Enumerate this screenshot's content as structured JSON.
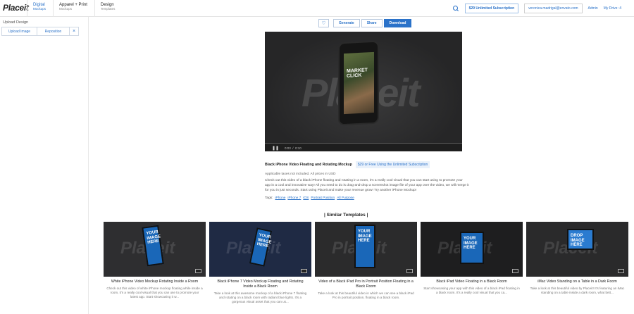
{
  "header": {
    "logo": "Placeit",
    "nav": [
      {
        "title": "Digital",
        "sub": "Mockups"
      },
      {
        "title": "Apparel + Print",
        "sub": "Mockups"
      },
      {
        "title": "Design",
        "sub": "Templates"
      }
    ],
    "subscription_label": "$29 Unlimited Subscription",
    "email": "veronica.madrigal@envato.com",
    "admin_label": "Admin",
    "drive_label": "My Drive: 4"
  },
  "sidebar": {
    "title": "Upload Design",
    "upload_label": "Upload Image",
    "reposition_label": "Reposition",
    "close_glyph": "×"
  },
  "actions": {
    "heart_glyph": "♡",
    "generate_label": "Generate",
    "share_label": "Share",
    "download_label": "Download"
  },
  "player": {
    "watermark": "Placeit",
    "screen_text": "MARKET\nCLICK",
    "pause_glyph": "❚❚",
    "time": "0:03  /  0:10"
  },
  "product": {
    "title": "Black iPhone Video Floating and Rotating Mockup",
    "price": "$29 or Free Using the Unlimited Subscription",
    "note": "Applicable taxes not included. All prices in USD",
    "description": "Check out this video of a black iPhone floating and rotating in a room, it's a really cool visual that you can start using to promote your app in a cool and innovative way! All you need to do is drag-and-drop a screenshot image file of your app over the video, we will merge it for you in just seconds. Start using Placeit and make your revenue grow! Try another iPhone Mockup!",
    "tags_label": "Tags:",
    "tags": [
      "iPhone",
      "iPhone 7",
      "iOS",
      "Portrait Position",
      "All Purpose"
    ]
  },
  "similar": {
    "heading": "| Similar Templates |",
    "cards": [
      {
        "title": "White iPhone Video Mockup Rotating Inside a Room",
        "desc": "Check out this video of white iPhone mockup floating while inside a room, it's a really cool visual that you can use to promote your latest app. Start showcasing it w...",
        "screen": "YOUR\nIMAGE\nHERE",
        "device_color": "#1a67b8",
        "bg": "#2e2e30"
      },
      {
        "title": "Black iPhone 7 Video Mockup Floating and Rotating Inside a Black Room",
        "desc": "Take a look at this awesome mockup of a black iPhone 7 floating and rotating on a black room with radiant blue lights. It's a gorgeous visual asset that you can us...",
        "screen": "YOUR\nIMAGE\nHERE",
        "device_color": "#1a67b8",
        "bg": "#1f2a44"
      },
      {
        "title": "Video of a Black iPad Pro in Portrait Position Floating in a Black Room",
        "desc": "Take a look at this beautiful video in which we can see a black iPad Pro in portrait position, floating in a black room.",
        "screen": "YOUR\nIMAGE\nHERE",
        "device_color": "#1a67b8",
        "bg": "#2b2b2c"
      },
      {
        "title": "Black iPad Video Floating in a Black Room",
        "desc": "Start showcasing your app with this video of a black iPad floating in a black room. It's a really cool visual that you ca...",
        "screen": "YOUR\nIMAGE\nHERE",
        "device_color": "#1a67b8",
        "bg": "#1e1e1f"
      },
      {
        "title": "iMac Video Standing on a Table in a Dark Room",
        "desc": "Take a look at this beautiful video by Placeit! It's featuring an iMac standing on a table inside a dark room, what bett...",
        "screen": "DROP\nIMAGE\nHERE",
        "device_color": "#2a7bd0",
        "bg": "#2a2a2b"
      }
    ]
  }
}
